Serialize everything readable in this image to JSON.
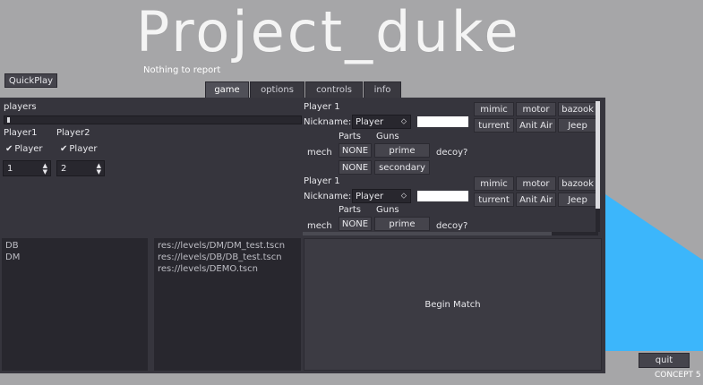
{
  "app": {
    "title": "Project_duke",
    "status": "Nothing to report"
  },
  "quickplay_label": "QuickPlay",
  "tabs": [
    {
      "label": "game",
      "active": true
    },
    {
      "label": "options",
      "active": false
    },
    {
      "label": "controls",
      "active": false
    },
    {
      "label": "info",
      "active": false
    }
  ],
  "players": {
    "header": "players",
    "slider_value": 0,
    "p1": {
      "label": "Player1",
      "check_label": "Player",
      "spin_value": "1"
    },
    "p2": {
      "label": "Player2",
      "check_label": "Player",
      "spin_value": "2"
    }
  },
  "player_cards": [
    {
      "heading": "Player 1",
      "nickname_label": "Nickname:",
      "nickname_value": "Player",
      "mech_label": "mech",
      "parts_label": "Parts",
      "guns_label": "Guns",
      "part1": "NONE",
      "part2": "NONE",
      "gun1": "prime",
      "gun2": "secondary",
      "decoy_label": "decoy?",
      "units": [
        "mimic",
        "motor",
        "bazook",
        "turrent",
        "Anit Air",
        "Jeep"
      ]
    },
    {
      "heading": "Player 1",
      "nickname_label": "Nickname:",
      "nickname_value": "Player",
      "mech_label": "mech",
      "parts_label": "Parts",
      "guns_label": "Guns",
      "part1": "NONE",
      "gun1": "prime",
      "decoy_label": "decoy?",
      "units": [
        "mimic",
        "motor",
        "bazook",
        "turrent",
        "Anit Air",
        "Jeep"
      ]
    }
  ],
  "modes": [
    "DB",
    "DM"
  ],
  "levels": [
    "res://levels/DM/DM_test.tscn",
    "res://levels/DB/DB_test.tscn",
    "res://levels/DEMO.tscn"
  ],
  "begin_match_label": "Begin Match",
  "quit_label": "quit",
  "footer_text": "CONCEPT 5",
  "colors": {
    "accent_blue": "#3cb6fb",
    "panel": "#36353d",
    "field": "#28272e"
  }
}
